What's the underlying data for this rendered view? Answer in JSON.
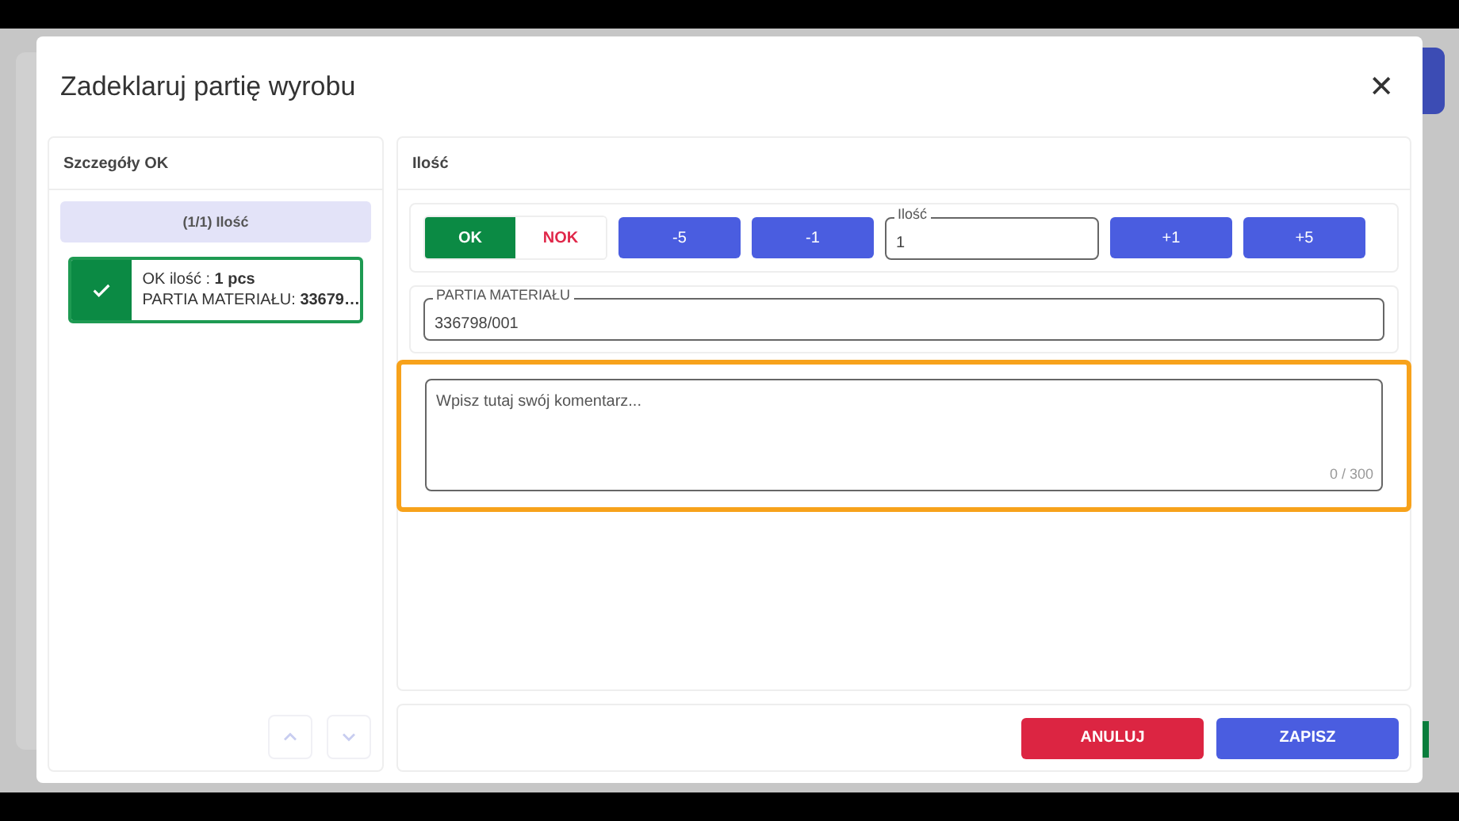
{
  "dialog": {
    "title": "Zadeklaruj partię wyrobu",
    "close": "✕"
  },
  "details_panel": {
    "title": "Szczegóły OK",
    "group": {
      "label": "(1/1) Ilość",
      "selected": true
    },
    "items": [
      {
        "kind": "ok",
        "selected": true,
        "lines": [
          "OK ilość : **1 pcs**",
          "PARTIA MATERIAŁU: **33679…**"
        ]
      }
    ],
    "scroll_up": {
      "disabled": true
    },
    "scroll_down": {
      "disabled": true
    }
  },
  "quantity_panel": {
    "title": "Ilość",
    "toggle": [
      {
        "label": "OK",
        "kind": "ok",
        "selected": true
      },
      {
        "label": "NOK",
        "kind": "nok",
        "selected": false
      }
    ],
    "decrements": [
      "-5",
      "-1"
    ],
    "quantity_field": {
      "label": "Ilość",
      "value": "1"
    },
    "increments": [
      "+1",
      "+5"
    ],
    "batch_field": {
      "label": "PARTIA MATERIAŁU",
      "value": "336798/001"
    },
    "comment": {
      "placeholder": "Wpisz tutaj swój komentarz...",
      "counter": "0 / 300",
      "highlighted": true
    }
  },
  "footer_buttons": [
    {
      "label": "ANULUJ",
      "kind": "cancel"
    },
    {
      "label": "ZAPISZ",
      "kind": "save"
    }
  ]
}
